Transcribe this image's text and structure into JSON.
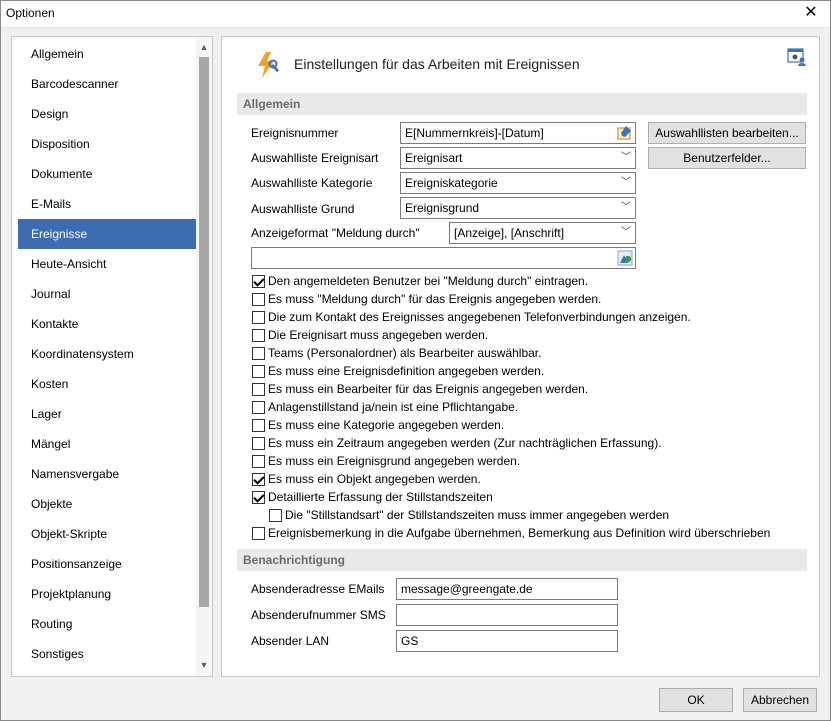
{
  "window": {
    "title": "Optionen",
    "close": "✕"
  },
  "sidebar": {
    "items": [
      "Allgemein",
      "Barcodescanner",
      "Design",
      "Disposition",
      "Dokumente",
      "E-Mails",
      "Ereignisse",
      "Heute-Ansicht",
      "Journal",
      "Kontakte",
      "Koordinatensystem",
      "Kosten",
      "Lager",
      "Mängel",
      "Namensvergabe",
      "Objekte",
      "Objekt-Skripte",
      "Positionsanzeige",
      "Projektplanung",
      "Routing",
      "Sonstiges"
    ],
    "selected": "Ereignisse"
  },
  "header": {
    "title": "Einstellungen für das Arbeiten mit Ereignissen"
  },
  "allgemein": {
    "section": "Allgemein",
    "ereignisnummer_label": "Ereignisnummer",
    "ereignisnummer_value": "E[Nummernkreis]-[Datum]",
    "art_label": "Auswahlliste Ereignisart",
    "art_value": "Ereignisart",
    "kategorie_label": "Auswahlliste Kategorie",
    "kategorie_value": "Ereigniskategorie",
    "grund_label": "Auswahlliste Grund",
    "grund_value": "Ereignisgrund",
    "format_label": "Anzeigeformat \"Meldung durch\"",
    "format_value": "[Anzeige], [Anschrift]",
    "extra_value": "",
    "btn_auswahllisten": "Auswahllisten bearbeiten...",
    "btn_benutzerfelder": "Benutzerfelder..."
  },
  "checks": [
    {
      "label": "Den angemeldeten Benutzer bei \"Meldung durch\" eintragen.",
      "checked": true
    },
    {
      "label": "Es muss \"Meldung durch\" für das Ereignis angegeben werden.",
      "checked": false
    },
    {
      "label": "Die zum Kontakt des Ereignisses angegebenen Telefonverbindungen anzeigen.",
      "checked": false
    },
    {
      "label": "Die Ereignisart muss angegeben werden.",
      "checked": false
    },
    {
      "label": "Teams (Personalordner) als Bearbeiter auswählbar.",
      "checked": false
    },
    {
      "label": "Es muss eine Ereignisdefinition angegeben werden.",
      "checked": false
    },
    {
      "label": "Es muss ein Bearbeiter für das Ereignis angegeben werden.",
      "checked": false
    },
    {
      "label": "Anlagenstillstand ja/nein ist eine Pflichtangabe.",
      "checked": false
    },
    {
      "label": "Es muss eine Kategorie angegeben werden.",
      "checked": false
    },
    {
      "label": "Es muss ein Zeitraum angegeben werden (Zur nachträglichen Erfassung).",
      "checked": false
    },
    {
      "label": "Es muss ein Ereignisgrund angegeben werden.",
      "checked": false
    },
    {
      "label": "Es muss ein Objekt angegeben werden.",
      "checked": true
    },
    {
      "label": "Detaillierte Erfassung der Stillstandszeiten",
      "checked": true
    },
    {
      "label": "Die \"Stillstandsart\" der Stillstandszeiten muss immer angegeben werden",
      "checked": false
    },
    {
      "label": "Ereignisbemerkung in die Aufgabe übernehmen, Bemerkung aus Definition wird überschrieben",
      "checked": false
    }
  ],
  "benachrichtigung": {
    "section": "Benachrichtigung",
    "email_label": "Absenderadresse EMails",
    "email_value": "message@greengate.de",
    "sms_label": "Absenderufnummer SMS",
    "sms_value": "",
    "lan_label": "Absender LAN",
    "lan_value": "GS"
  },
  "footer": {
    "ok": "OK",
    "cancel": "Abbrechen"
  },
  "colors": {
    "selection": "#3d6cb1",
    "section_bg": "#e9e9e9"
  }
}
